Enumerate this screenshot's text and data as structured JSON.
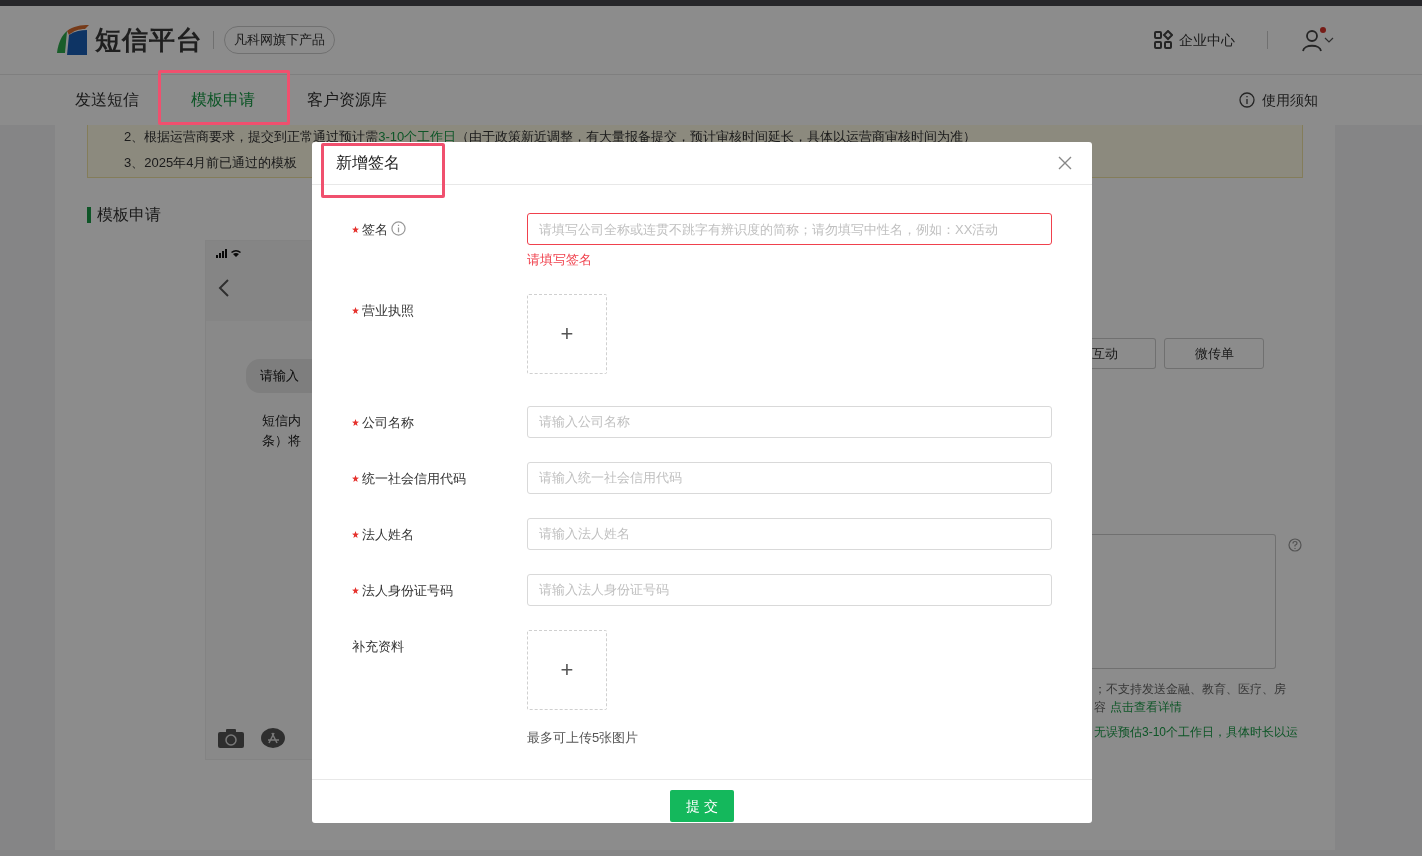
{
  "header": {
    "logo_text": "短信平台",
    "tagline": "凡科网旗下产品",
    "enterprise_center": "企业中心",
    "has_unread": true
  },
  "nav": {
    "tabs": [
      {
        "label": "发送短信",
        "selected": false
      },
      {
        "label": "模板申请",
        "selected": true
      },
      {
        "label": "客户资源库",
        "selected": false
      }
    ],
    "help": "使用须知"
  },
  "notice": {
    "line_2": {
      "before": "2、根据运营商要求，提交到正常通过预计需",
      "highlight": "3-10个工作日",
      "after": "（由于政策新近调整，有大量报备提交，预计审核时间延长，具体以运营商审核时间为准）"
    },
    "line_3": "3、2025年4月前已通过的模板"
  },
  "section_title": "模板申请",
  "preview": {
    "bubble": "请输入",
    "content_lines": [
      "短信内",
      "条）将"
    ]
  },
  "right_panel": {
    "type_buttons": [
      "互动",
      "微传单"
    ],
    "hint_line_1": "；不支持发送金融、教育、医疗、房",
    "hint_line_2": {
      "text": "容",
      "link": "点击查看详情"
    },
    "green_note": "无误预估3-10个工作日，具体时长以运"
  },
  "dialog": {
    "title": "新增签名",
    "fields": [
      {
        "kind": "text",
        "label": "签名",
        "required": true,
        "info": true,
        "invalid": true,
        "placeholder": "请填写公司全称或连贯不跳字有辨识度的简称；请勿填写中性名，例如：XX活动",
        "error": "请填写签名"
      },
      {
        "kind": "upload",
        "label": "营业执照",
        "required": true,
        "button": "+"
      },
      {
        "kind": "text",
        "label": "公司名称",
        "required": true,
        "info": false,
        "invalid": false,
        "placeholder": "请输入公司名称"
      },
      {
        "kind": "text",
        "label": "统一社会信用代码",
        "required": true,
        "info": false,
        "invalid": false,
        "placeholder": "请输入统一社会信用代码"
      },
      {
        "kind": "text",
        "label": "法人姓名",
        "required": true,
        "info": false,
        "invalid": false,
        "placeholder": "请输入法人姓名"
      },
      {
        "kind": "text",
        "label": "法人身份证号码",
        "required": true,
        "info": false,
        "invalid": false,
        "placeholder": "请输入法人身份证号码"
      },
      {
        "kind": "upload",
        "label": "补充资料",
        "required": false,
        "button": "+",
        "note": "最多可上传5张图片"
      }
    ],
    "submit": "提 交"
  }
}
